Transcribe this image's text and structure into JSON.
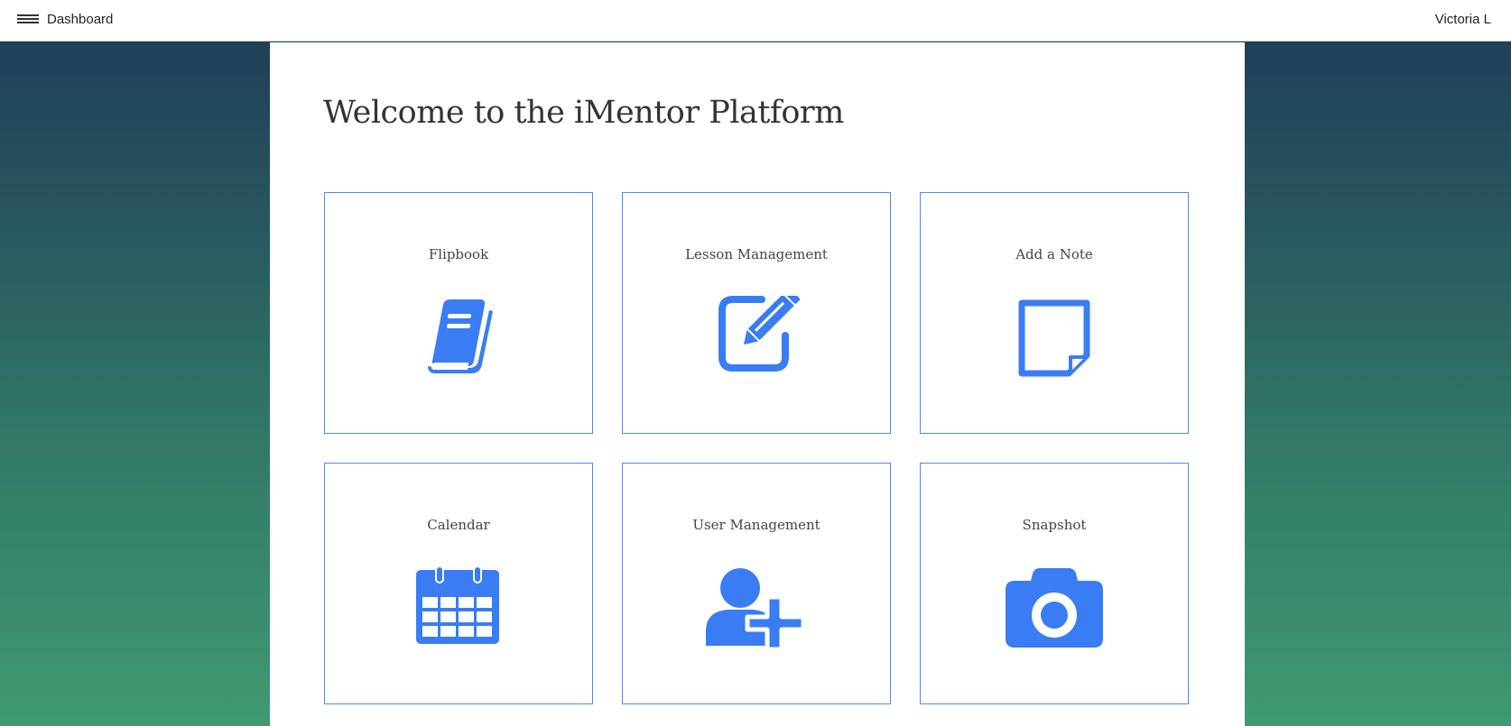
{
  "header": {
    "title": "Dashboard",
    "user_name": "Victoria L",
    "menu_icon": "hamburger-icon"
  },
  "main": {
    "heading": "Welcome to the iMentor Platform",
    "accent_color": "#3a7cf4",
    "tiles": [
      {
        "label": "Flipbook",
        "icon": "book-icon"
      },
      {
        "label": "Lesson Management",
        "icon": "edit-icon"
      },
      {
        "label": "Add a Note",
        "icon": "note-icon"
      },
      {
        "label": "Calendar",
        "icon": "calendar-icon"
      },
      {
        "label": "User Management",
        "icon": "add-user-icon"
      },
      {
        "label": "Snapshot",
        "icon": "camera-icon"
      }
    ]
  }
}
